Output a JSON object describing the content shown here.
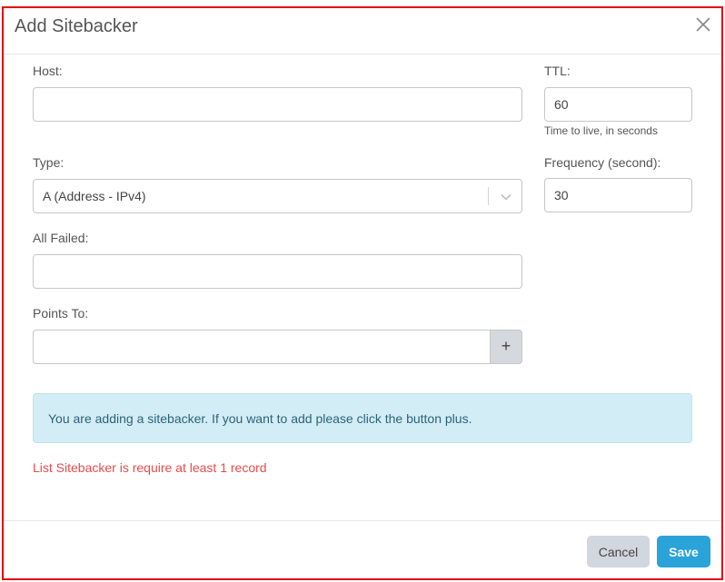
{
  "dialog": {
    "title": "Add Sitebacker"
  },
  "fields": {
    "host": {
      "label": "Host:",
      "value": ""
    },
    "ttl": {
      "label": "TTL:",
      "value": "60",
      "hint": "Time to live, in seconds"
    },
    "type": {
      "label": "Type:",
      "selected": "A (Address - IPv4)"
    },
    "frequency": {
      "label": "Frequency (second):",
      "value": "30"
    },
    "all_failed": {
      "label": "All Failed:",
      "value": ""
    },
    "points_to": {
      "label": "Points To:",
      "value": "",
      "add_label": "+"
    }
  },
  "messages": {
    "info": "You are adding a sitebacker. If you want to add please click the button plus.",
    "error": "List Sitebacker is require at least 1 record"
  },
  "footer": {
    "cancel_label": "Cancel",
    "save_label": "Save"
  },
  "colors": {
    "frame": "#e3000f",
    "info_bg": "#d3edf6",
    "error": "#e74c4c",
    "primary": "#2aa3d8"
  },
  "icons": {
    "close": "close-icon",
    "chevron": "chevron-down-icon"
  }
}
